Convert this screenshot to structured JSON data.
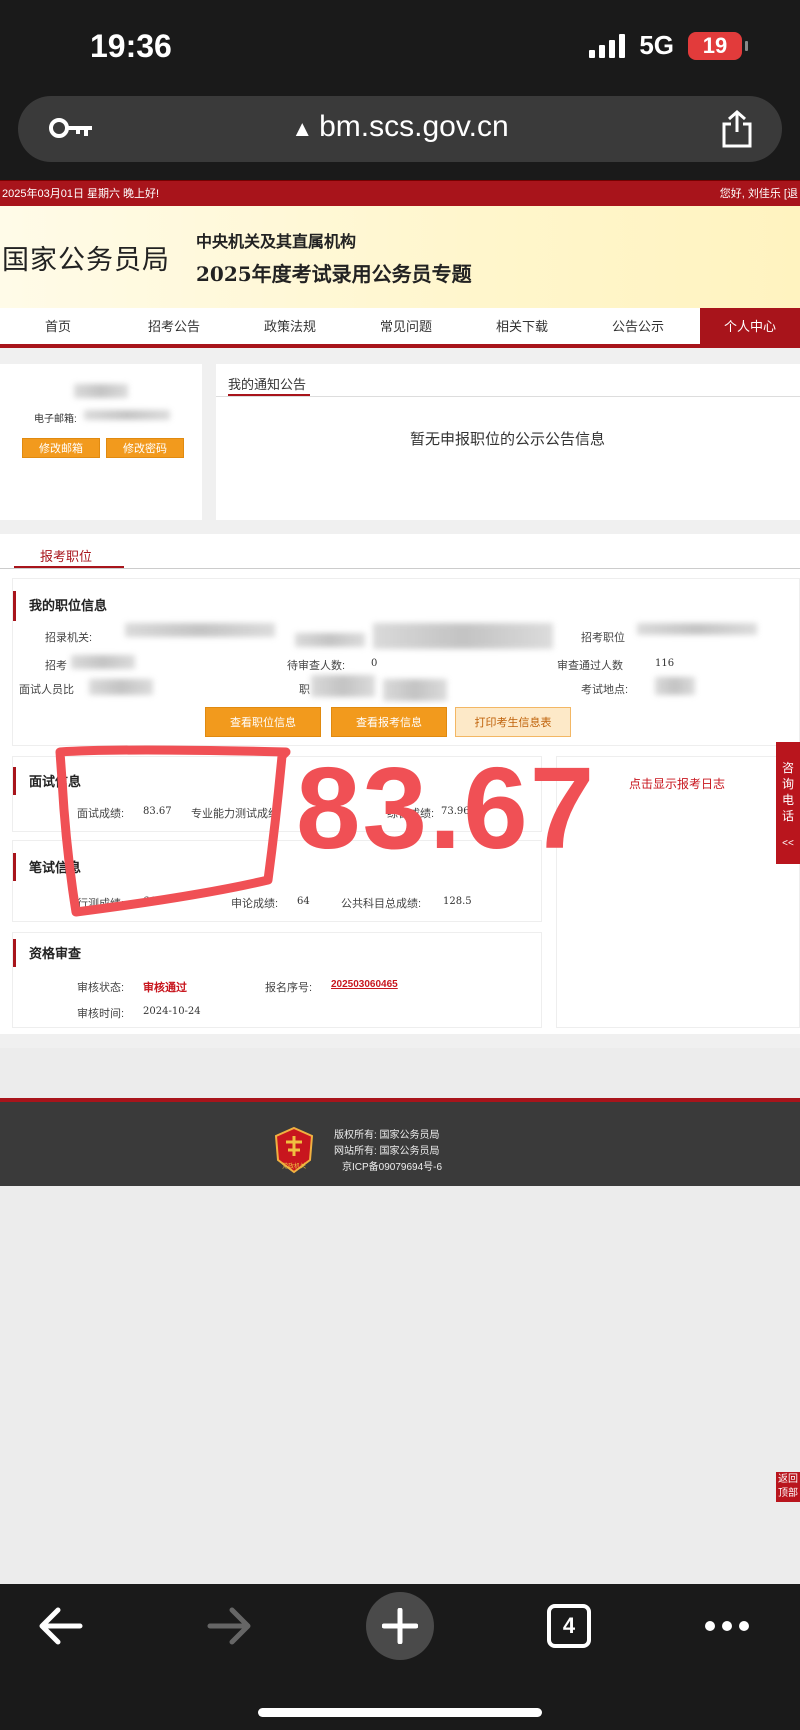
{
  "phone": {
    "time": "19:36",
    "network": "5G",
    "battery": "19"
  },
  "browser": {
    "url": "bm.scs.gov.cn",
    "tab_count": "4"
  },
  "site": {
    "date_line": "2025年03月01日  星期六  晚上好!",
    "greeting": "您好, 刘佳乐  [退",
    "logo": "国家公务员局",
    "banner_line1": "中央机关及其直属机构",
    "banner_line2": "2025年度考试录用公务员专题",
    "nav": [
      "首页",
      "招考公告",
      "政策法规",
      "常见问题",
      "相关下载",
      "公告公示",
      "个人中心"
    ]
  },
  "account": {
    "email_label": "电子邮箱:",
    "change_email": "修改邮箱",
    "change_password": "修改密码"
  },
  "notice": {
    "tab": "我的通知公告",
    "empty": "暂无申报职位的公示公告信息"
  },
  "apply": {
    "tab": "报考职位",
    "position_title": "我的职位信息",
    "labels": {
      "org": "招录机关:",
      "position": "招考职位",
      "exam_partial": "招考",
      "pending": "待审查人数:",
      "pending_value": "0",
      "approved": "审查通过人数",
      "approved_value": "116",
      "interview_ratio": "面试人员比",
      "exam_place": "考试地点:",
      "position_partial": "职"
    },
    "buttons": {
      "view_position": "查看职位信息",
      "view_apply": "查看报考信息",
      "print": "打印考生信息表"
    },
    "interview": {
      "title": "面试信息",
      "score_label": "面试成绩:",
      "score_value": "83.67",
      "pro_label": "专业能力测试成绩",
      "total_label": "综合成绩:",
      "total_value": "73.96"
    },
    "written": {
      "title": "笔试信息",
      "xc_label": "行测成绩:",
      "xc_value": "64.5",
      "sl_label": "申论成绩:",
      "sl_value": "64",
      "total_label": "公共科目总成绩:",
      "total_value": "128.5"
    },
    "qualification": {
      "title": "资格审查",
      "status_label": "审核状态:",
      "status_value": "审核通过",
      "reg_label": "报名序号:",
      "reg_value": "202503060465",
      "time_label": "审核时间:",
      "time_value": "2024-10-24"
    },
    "log_link": "点击显示报考日志"
  },
  "side": {
    "consult": "咨询电话",
    "collapse": "<<",
    "back_top": "返回顶部"
  },
  "annotation": {
    "number": "83.67"
  },
  "footer": {
    "copyright": "版权所有:  国家公务员局",
    "site_owner": "网站所有:  国家公务员局",
    "icp": "京ICP备09079694号-6",
    "emblem_text": "党政机关"
  }
}
